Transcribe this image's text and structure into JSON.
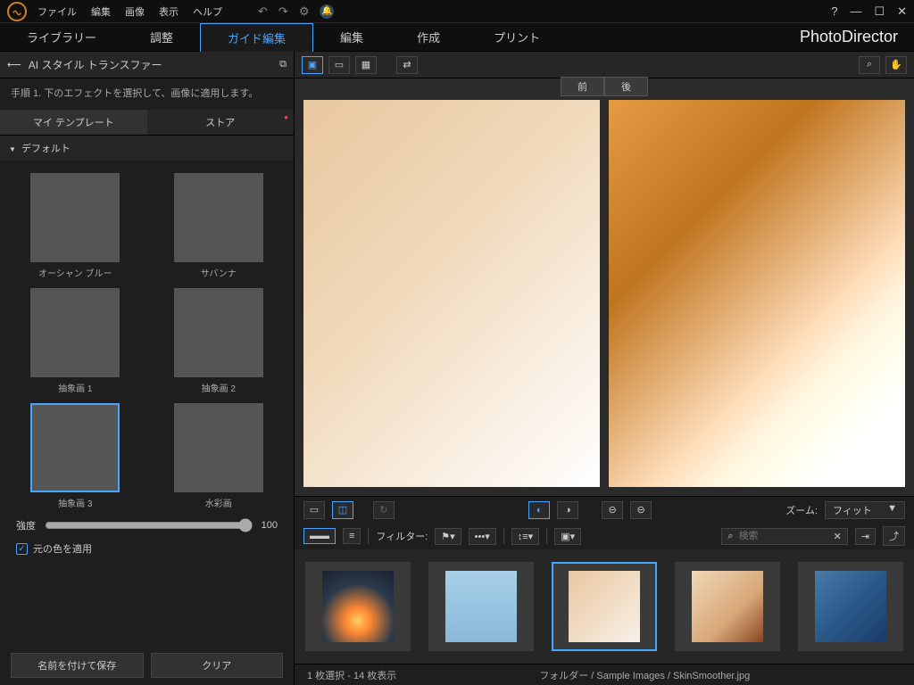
{
  "menu": [
    "ファイル",
    "編集",
    "画像",
    "表示",
    "ヘルプ"
  ],
  "tabs": [
    "ライブラリー",
    "調整",
    "ガイド編集",
    "編集",
    "作成",
    "プリント"
  ],
  "active_tab": 2,
  "brand": "PhotoDirector",
  "panel": {
    "title": "AI スタイル トランスファー",
    "instruction": "手順 1. 下のエフェクトを選択して、画像に適用します。",
    "subtabs": [
      "マイ テンプレート",
      "ストア"
    ],
    "active_subtab": 0,
    "section": "デフォルト",
    "thumbs": [
      {
        "label": "オーシャン ブルー",
        "art": "art-wave"
      },
      {
        "label": "サバンナ",
        "art": "art-sav"
      },
      {
        "label": "抽象画 1",
        "art": "art-ab1"
      },
      {
        "label": "抽象画 2",
        "art": "art-ab2"
      },
      {
        "label": "抽象画 3",
        "art": "art-ab3"
      },
      {
        "label": "水彩画",
        "art": "art-water"
      }
    ],
    "selected_thumb": 4,
    "intensity_label": "強度",
    "intensity_value": "100",
    "checkbox_label": "元の色を適用",
    "btn_save": "名前を付けて保存",
    "btn_clear": "クリア"
  },
  "preview": {
    "before": "前",
    "after": "後"
  },
  "strip": {
    "zoom_label": "ズーム:",
    "zoom_value": "フィット",
    "filter_label": "フィルター:",
    "search_placeholder": "検索"
  },
  "film": [
    {
      "art": "film-rocket"
    },
    {
      "art": "film-skate"
    },
    {
      "art": "film-portrait"
    },
    {
      "art": "film-woman"
    },
    {
      "art": "film-wave2"
    }
  ],
  "film_selected": 2,
  "status": {
    "left": "1 枚選択 - 14 枚表示",
    "right": "フォルダー / Sample Images / SkinSmoother.jpg"
  }
}
